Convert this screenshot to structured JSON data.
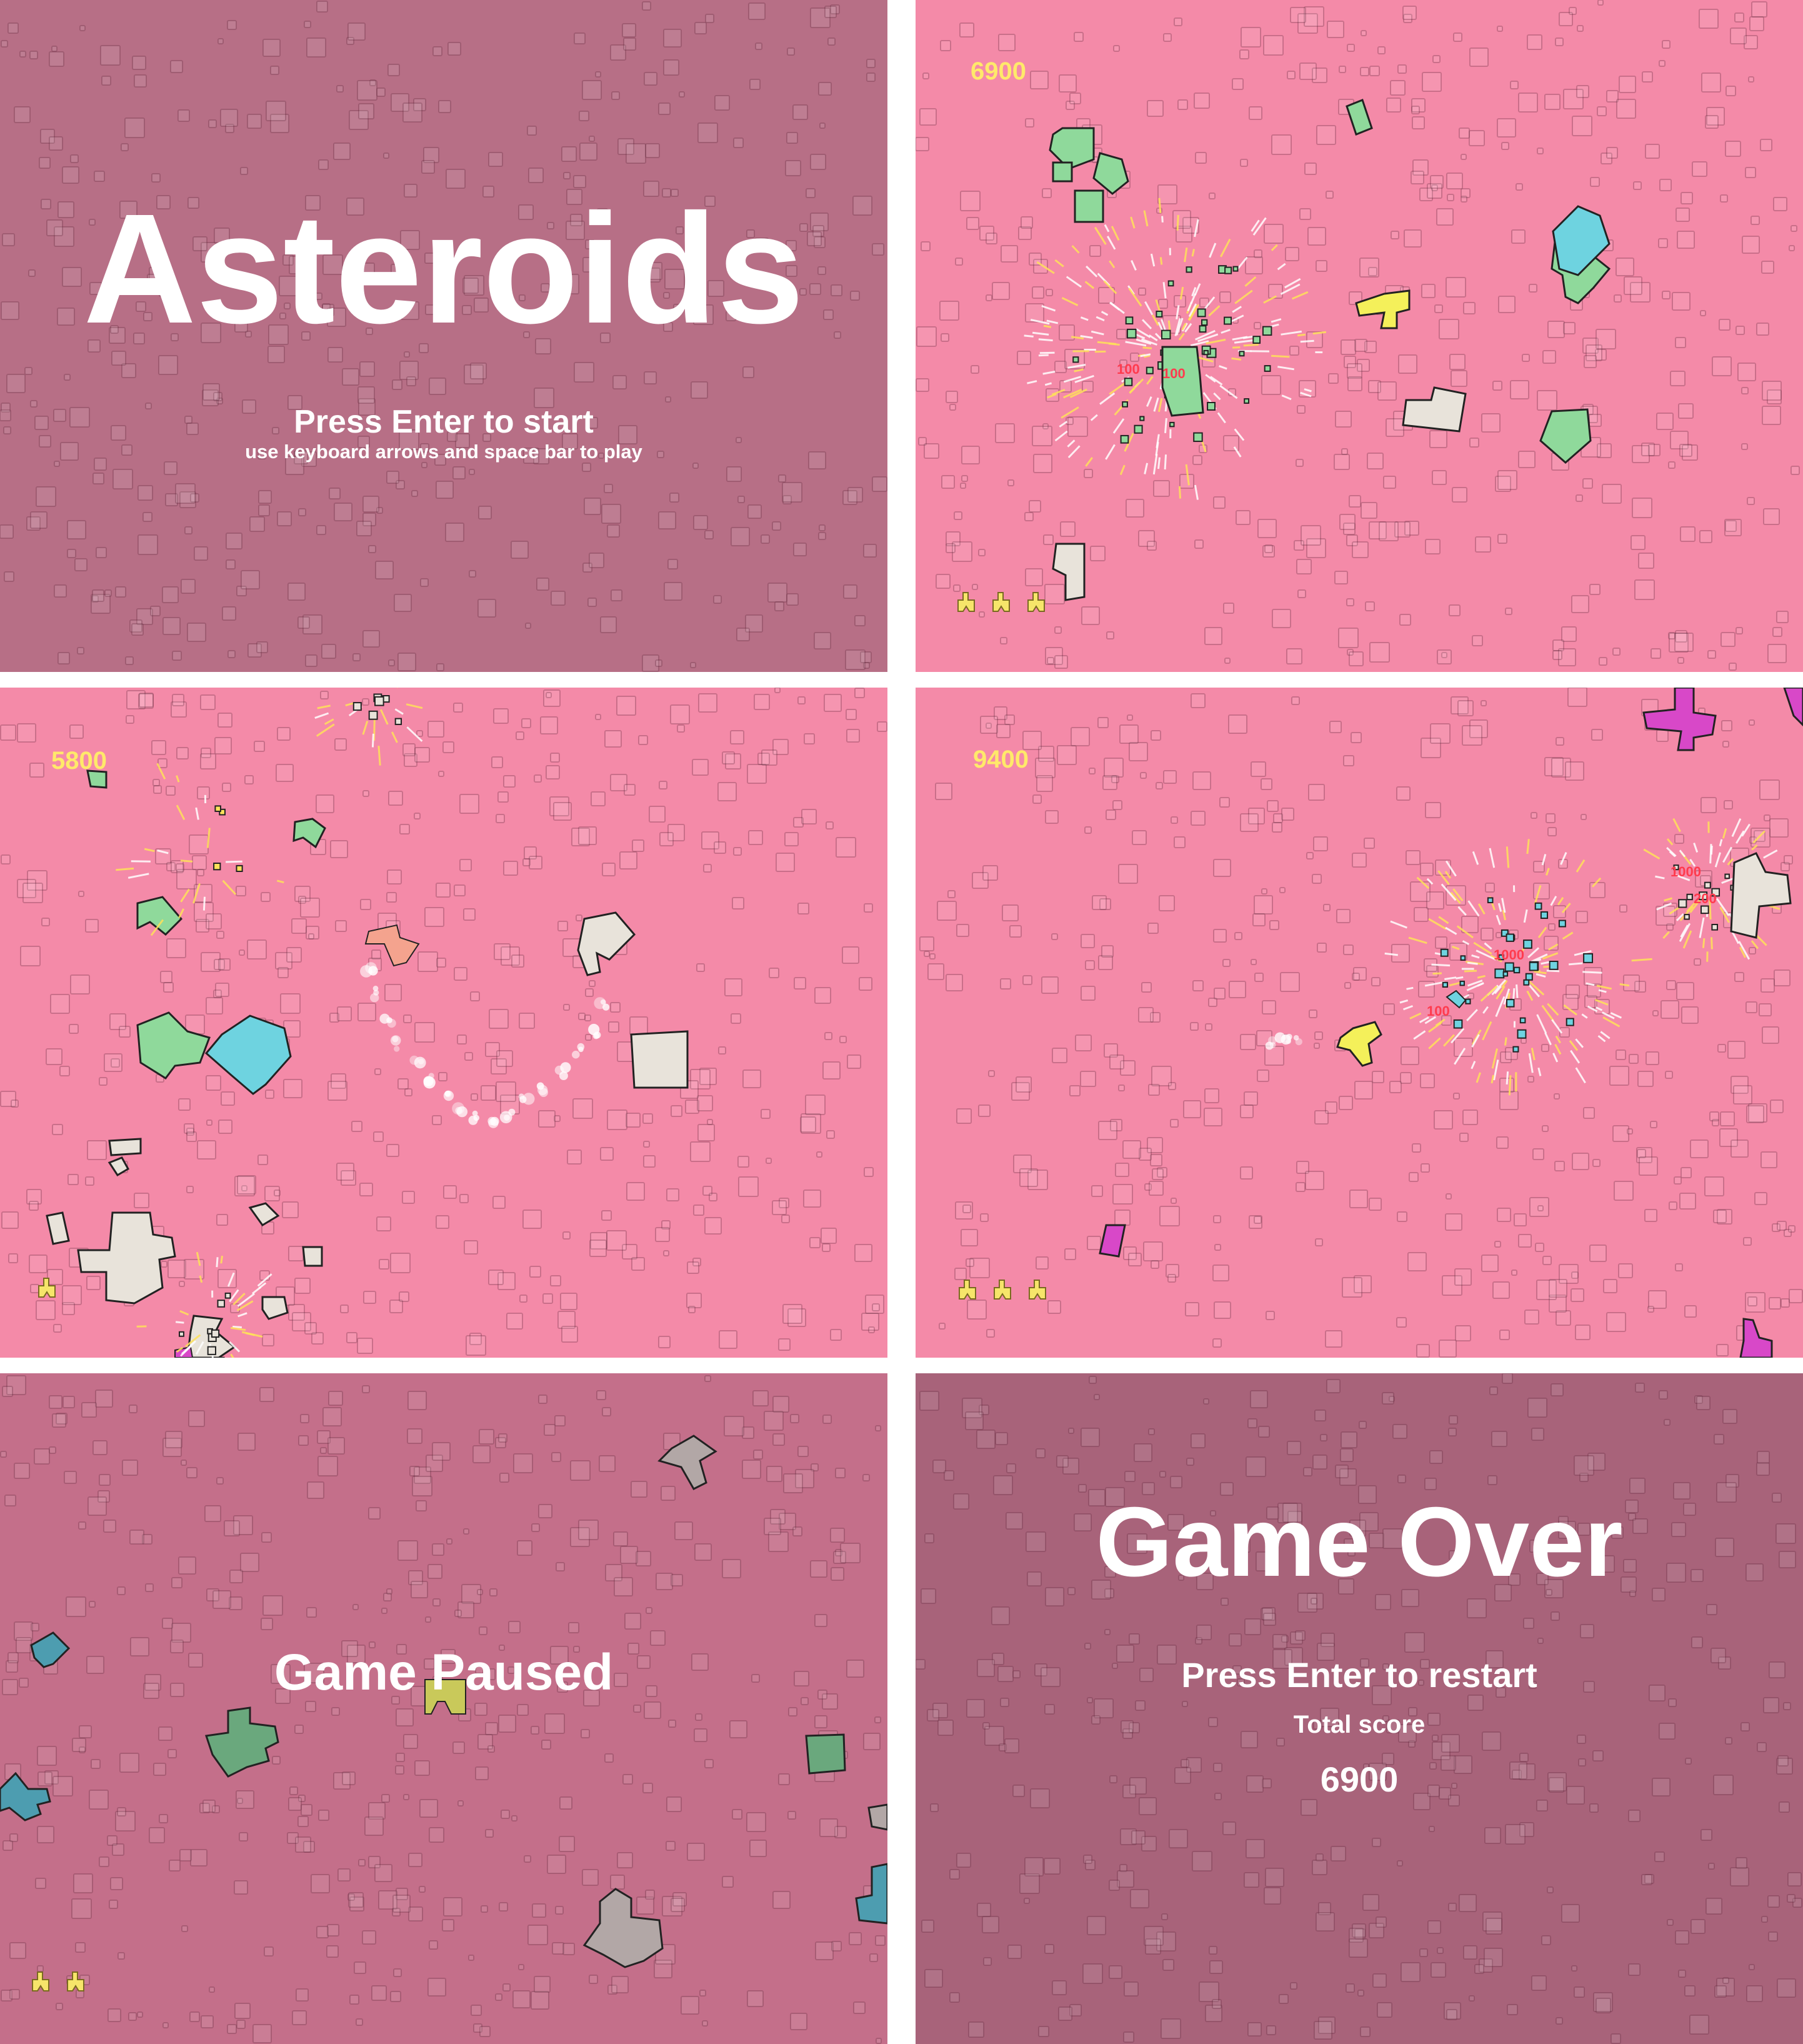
{
  "screens": {
    "title": {
      "heading": "Asteroids",
      "prompt": "Press Enter to start",
      "hint": "use keyboard arrows and space bar to play"
    },
    "gameplay_1": {
      "score": "6900",
      "points": [
        "100",
        "100"
      ],
      "lives": 3
    },
    "gameplay_2": {
      "score": "5800",
      "lives": 1
    },
    "gameplay_3": {
      "score": "9400",
      "points": [
        "1000",
        "200",
        "1000",
        "100"
      ],
      "lives": 3
    },
    "paused": {
      "message": "Game Paused",
      "lives": 2
    },
    "game_over": {
      "heading": "Game Over",
      "prompt": "Press Enter to restart",
      "total_label": "Total score",
      "total_value": "6900"
    }
  },
  "colors": {
    "playfield": "#f48aa8",
    "overlay_title": "#b76f86",
    "overlay_paused": "#c46f8a",
    "overlay_gameover": "#a8637a",
    "score": "#ffe96a",
    "ship": "#f6e56a",
    "points_text": "#ff3b4e",
    "asteroid_green": "#8fd99b",
    "asteroid_cyan": "#6ed3e0",
    "asteroid_yellow": "#f4f05a",
    "asteroid_grey": "#e8e3da",
    "asteroid_magenta": "#d848c8",
    "asteroid_salmon": "#f4a38e"
  }
}
